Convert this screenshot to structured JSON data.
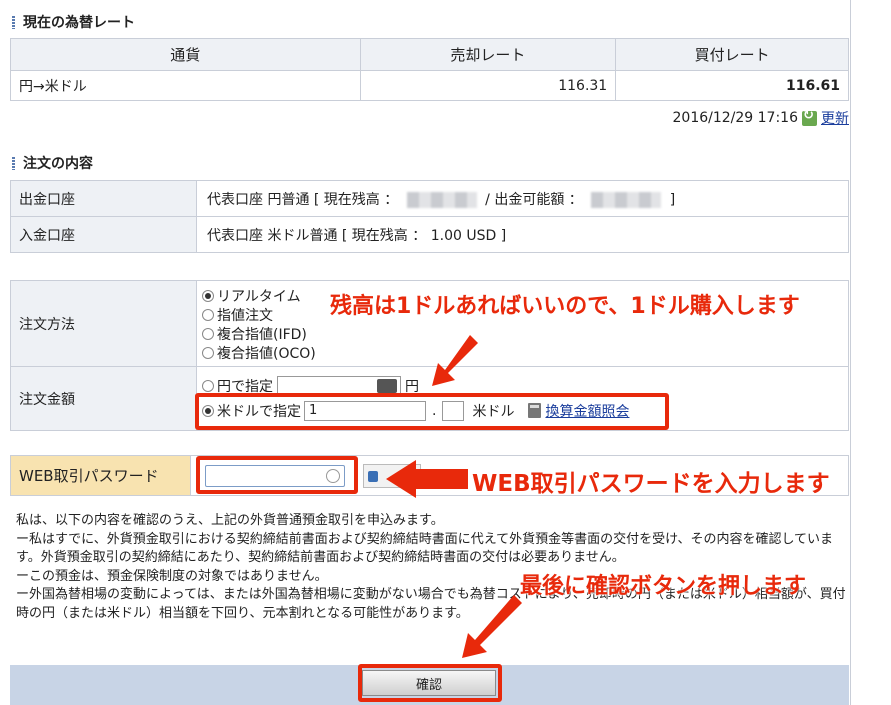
{
  "current_rate": {
    "title": "現在の為替レート",
    "headers": [
      "通貨",
      "売却レート",
      "買付レート"
    ],
    "row": {
      "currency": "円→米ドル",
      "sell": "116.31",
      "buy": "116.61"
    },
    "timestamp": "2016/12/29 17:16",
    "refresh_label": "更新"
  },
  "order": {
    "title": "注文の内容",
    "withdraw_label": "出金口座",
    "withdraw_value_a": "代表口座 円普通 [ 現在残高 ：",
    "withdraw_value_b": "/ 出金可能額 ：",
    "withdraw_value_c": "]",
    "deposit_label": "入金口座",
    "deposit_value": "代表口座 米ドル普通 [ 現在残高 ： 1.00 USD ]",
    "method_label": "注文方法",
    "methods": [
      "リアルタイム",
      "指値注文",
      "複合指値(IFD)",
      "複合指値(OCO)"
    ],
    "amount_label": "注文金額",
    "yen_option": "円で指定",
    "yen_unit": "円",
    "usd_option": "米ドルで指定",
    "usd_value": "1",
    "decimal_point": ".",
    "usd_unit": "米ドル",
    "convert_link": "換算金額照会"
  },
  "password": {
    "label": "WEB取引パスワード"
  },
  "notice": [
    "私は、以下の内容を確認のうえ、上記の外貨普通預金取引を申込みます。",
    "ー私はすでに、外貨預金取引における契約締結前書面および契約締結時書面に代えて外貨預金等書面の交付を受け、その内容を確認しています。外貨預金取引の契約締結にあたり、契約締結前書面および契約締結時書面の交付は必要ありません。",
    "ーこの預金は、預金保険制度の対象ではありません。",
    "ー外国為替相場の変動によっては、または外国為替相場に変動がない場合でも為替コストにより、売却時の円（または米ドル）相当額が、買付時の円（または米ドル）相当額を下回り、元本割れとなる可能性があります。"
  ],
  "confirm_label": "確認",
  "annotations": {
    "a1": "残高は1ドルあればいいので、1ドル購入します",
    "a2": "WEB取引パスワードを入力します",
    "a3": "最後に確認ボタンを押します",
    "color": "#e8290b"
  }
}
